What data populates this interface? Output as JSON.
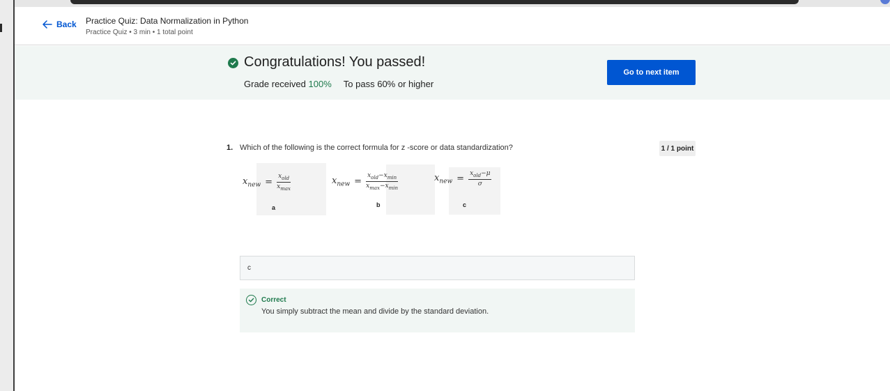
{
  "header": {
    "back_label": "Back",
    "title": "Practice Quiz: Data Normalization in Python",
    "meta": "Practice Quiz • 3 min • 1 total point"
  },
  "result": {
    "title": "Congratulations! You passed!",
    "grade_label": "Grade received",
    "grade_value": "100%",
    "pass_label": "To pass",
    "pass_value": "60% or higher",
    "next_button": "Go to next item"
  },
  "question": {
    "number": "1.",
    "text": "Which of the following is the correct formula for z -score or data standardization?",
    "points": "1 / 1 point",
    "options": [
      {
        "label": "a",
        "lhs": "x",
        "lhs_sub": "new",
        "num": "x",
        "num_sub": "old",
        "den": "x",
        "den_sub": "max"
      },
      {
        "label": "b",
        "lhs": "x",
        "lhs_sub": "new",
        "num": "x",
        "num_sub": "old",
        "num2": "−x",
        "num2_sub": "min",
        "den": "x",
        "den_sub": "max",
        "den2": "−x",
        "den2_sub": "min"
      },
      {
        "label": "c",
        "lhs": "x",
        "lhs_sub": "new",
        "num": "x",
        "num_sub": "old",
        "num2": "−μ",
        "den": "σ"
      }
    ],
    "equals": "="
  },
  "answer": {
    "selected": "c"
  },
  "feedback": {
    "status": "Correct",
    "text": "You simply subtract the mean and divide by the standard deviation."
  },
  "colors": {
    "accent": "#0056d2",
    "success": "#1f7a4d",
    "banner_bg": "#f1f6f4"
  }
}
